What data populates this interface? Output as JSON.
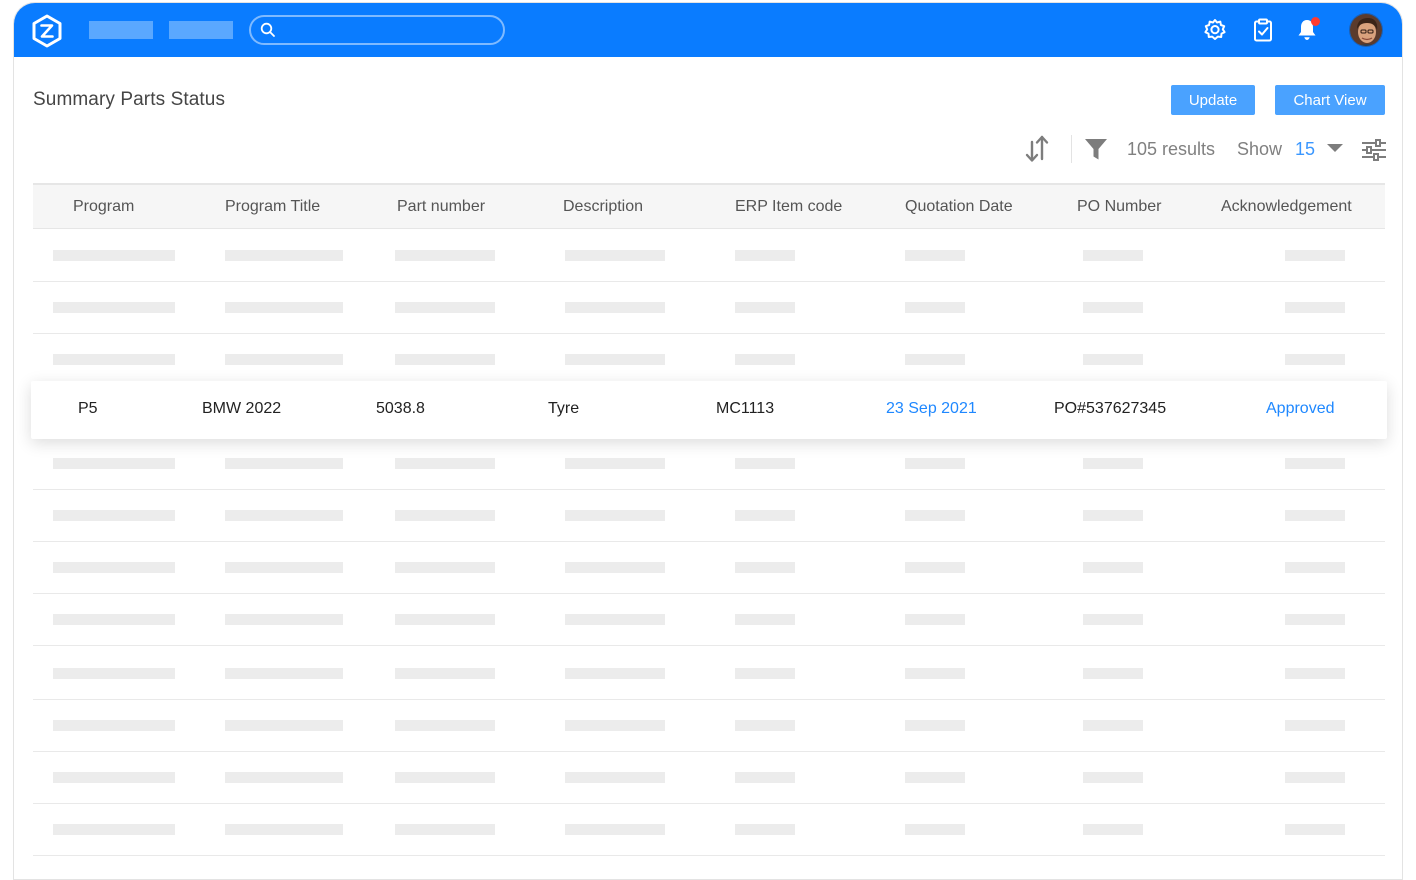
{
  "header": {
    "search_placeholder": ""
  },
  "page": {
    "title": "Summary Parts Status"
  },
  "actions": {
    "update_label": "Update",
    "chart_view_label": "Chart View"
  },
  "toolbar": {
    "results": "105 results",
    "show_label": "Show",
    "show_value": "15"
  },
  "table": {
    "columns": [
      "Program",
      "Program Title",
      "Part number",
      "Description",
      "ERP Item code",
      "Quotation Date",
      "PO Number",
      "Acknowledgement"
    ],
    "highlighted_row": {
      "program": "P5",
      "program_title": "BMW 2022",
      "part_number": "5038.8",
      "description": "Tyre",
      "erp_item_code": "MC1113",
      "quotation_date": "23 Sep 2021",
      "po_number": "PO#537627345",
      "acknowledgement": "Approved"
    }
  },
  "colors": {
    "topbar": "#0a7cff",
    "button": "#4aa2ff",
    "link": "#1f88ff",
    "notification_dot": "#ff3b30"
  }
}
